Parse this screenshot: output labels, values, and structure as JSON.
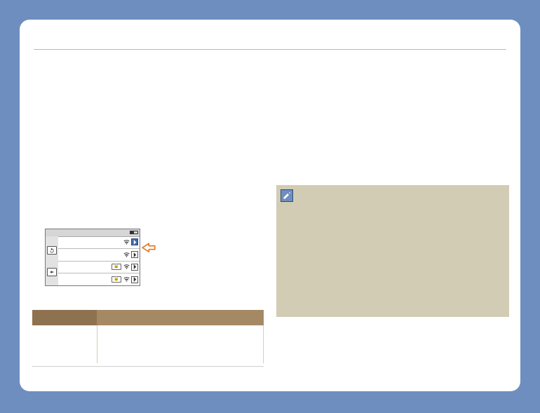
{
  "wifi_panel": {
    "title": "",
    "rows": [
      {
        "name": "",
        "locked": false,
        "selected": true
      },
      {
        "name": "",
        "locked": false,
        "selected": false
      },
      {
        "name": "",
        "locked": true,
        "selected": false
      },
      {
        "name": "",
        "locked": true,
        "selected": false
      }
    ],
    "refresh_label": "",
    "back_label": ""
  },
  "icons": {
    "refresh": "refresh-icon",
    "back": "back-icon",
    "wifi": "wifi-icon",
    "lock": "lock-icon",
    "arrow": "chevron-right-icon",
    "hand": "hand-pointer-icon",
    "note": "pencil-note-icon"
  },
  "table": {
    "headers": [
      "",
      ""
    ],
    "rows": [
      [
        "",
        ""
      ]
    ]
  },
  "note": {
    "text": ""
  }
}
